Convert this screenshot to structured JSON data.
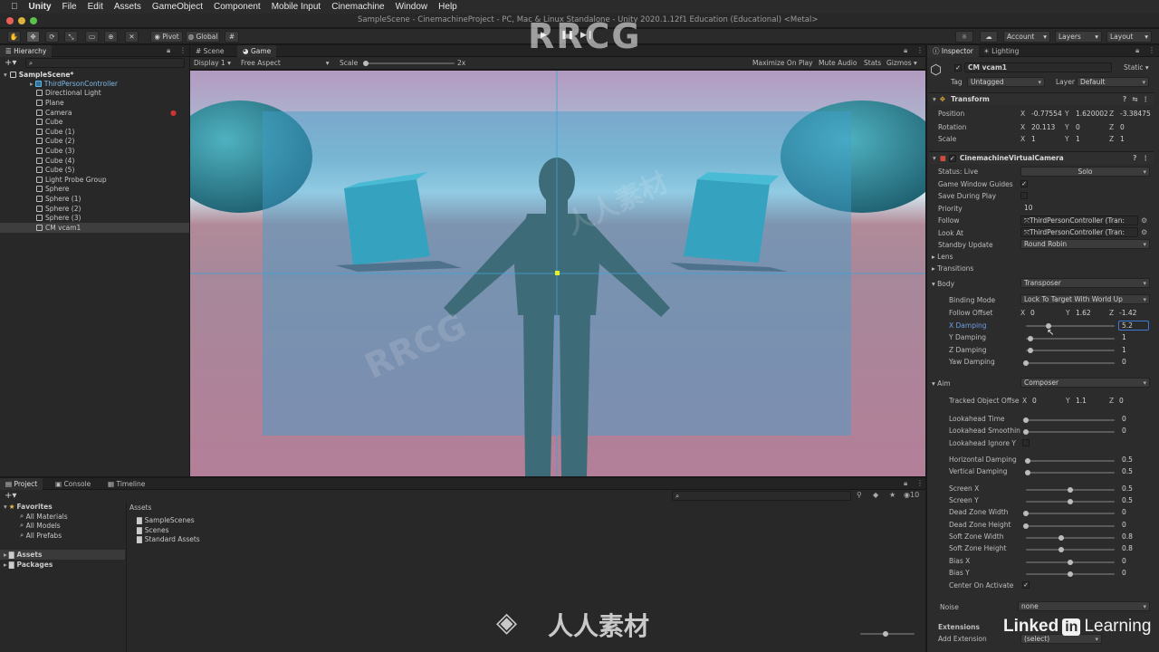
{
  "menubar": {
    "app": "Unity",
    "items": [
      "File",
      "Edit",
      "Assets",
      "GameObject",
      "Component",
      "Mobile Input",
      "Cinemachine",
      "Window",
      "Help"
    ]
  },
  "window_title": "SampleScene - CinemachineProject - PC, Mac & Linux Standalone - Unity 2020.1.12f1 Education (Educational) <Metal>",
  "toolbar": {
    "pivot": "Pivot",
    "global": "Global",
    "account": "Account",
    "layers": "Layers",
    "layout": "Layout"
  },
  "hierarchy": {
    "tab": "Hierarchy",
    "scene": "SampleScene*",
    "items": [
      "ThirdPersonController",
      "Directional Light",
      "Plane",
      "Camera",
      "Cube",
      "Cube (1)",
      "Cube (2)",
      "Cube (3)",
      "Cube (4)",
      "Cube (5)",
      "Light Probe Group",
      "Sphere",
      "Sphere (1)",
      "Sphere (2)",
      "Sphere (3)",
      "CM vcam1"
    ]
  },
  "view_tabs": {
    "scene": "Scene",
    "game": "Game",
    "display": "Display 1",
    "aspect": "Free Aspect",
    "scale_label": "Scale",
    "scale_value": "2x",
    "maximize": "Maximize On Play",
    "mute": "Mute Audio",
    "stats": "Stats",
    "gizmos": "Gizmos"
  },
  "project": {
    "tabs": [
      "Project",
      "Console",
      "Timeline"
    ],
    "favorites": "Favorites",
    "favorite_items": [
      "All Materials",
      "All Models",
      "All Prefabs"
    ],
    "roots": [
      "Assets",
      "Packages"
    ],
    "assets_header": "Assets",
    "asset_items": [
      "SampleScenes",
      "Scenes",
      "Standard Assets"
    ],
    "count": "10"
  },
  "inspector": {
    "tabs": [
      "Inspector",
      "Lighting"
    ],
    "object_name": "CM vcam1",
    "static": "Static",
    "tag_label": "Tag",
    "tag": "Untagged",
    "layer_label": "Layer",
    "layer": "Default",
    "transform": {
      "title": "Transform",
      "position_label": "Position",
      "position": [
        "-0.77554",
        "1.620002",
        "-3.38475"
      ],
      "rotation_label": "Rotation",
      "rotation": [
        "20.113",
        "0",
        "0"
      ],
      "scale_label": "Scale",
      "scale": [
        "1",
        "1",
        "1"
      ]
    },
    "vcam": {
      "title": "CinemachineVirtualCamera",
      "status": "Status: Live",
      "solo": "Solo",
      "game_window_guides": "Game Window Guides",
      "save_during_play": "Save During Play",
      "priority_label": "Priority",
      "priority": "10",
      "follow_label": "Follow",
      "follow": "ThirdPersonController (Tran:",
      "look_at_label": "Look At",
      "look_at": "ThirdPersonController (Tran:",
      "standby_label": "Standby Update",
      "standby": "Round Robin",
      "lens": "Lens",
      "transitions": "Transitions"
    },
    "body": {
      "label": "Body",
      "value": "Transposer",
      "binding_mode_label": "Binding Mode",
      "binding_mode": "Lock To Target With World Up",
      "follow_offset_label": "Follow Offset",
      "follow_offset": [
        "0",
        "1.62",
        "-1.42"
      ],
      "x_damping_label": "X Damping",
      "x_damping": "5.2",
      "x_damping_fraction": 0.26,
      "y_damping_label": "Y Damping",
      "y_damping": "1",
      "y_damping_fraction": 0.05,
      "z_damping_label": "Z Damping",
      "z_damping": "1",
      "z_damping_fraction": 0.05,
      "yaw_damping_label": "Yaw Damping",
      "yaw_damping": "0",
      "yaw_damping_fraction": 0.0
    },
    "aim": {
      "label": "Aim",
      "value": "Composer",
      "tracked_offset_label": "Tracked Object Offse",
      "tracked_offset": [
        "0",
        "1.1",
        "0"
      ],
      "sliders": [
        {
          "label": "Lookahead Time",
          "value": "0",
          "fraction": 0.0
        },
        {
          "label": "Lookahead Smoothin",
          "value": "0",
          "fraction": 0.0
        },
        {
          "label": "Horizontal Damping",
          "value": "0.5",
          "fraction": 0.02
        },
        {
          "label": "Vertical Damping",
          "value": "0.5",
          "fraction": 0.02
        },
        {
          "label": "Screen X",
          "value": "0.5",
          "fraction": 0.5
        },
        {
          "label": "Screen Y",
          "value": "0.5",
          "fraction": 0.5
        },
        {
          "label": "Dead Zone Width",
          "value": "0",
          "fraction": 0.0
        },
        {
          "label": "Dead Zone Height",
          "value": "0",
          "fraction": 0.0
        },
        {
          "label": "Soft Zone Width",
          "value": "0.8",
          "fraction": 0.4
        },
        {
          "label": "Soft Zone Height",
          "value": "0.8",
          "fraction": 0.4
        },
        {
          "label": "Bias X",
          "value": "0",
          "fraction": 0.5
        },
        {
          "label": "Bias Y",
          "value": "0",
          "fraction": 0.5
        }
      ],
      "lookahead_ignore_y": "Lookahead Ignore Y",
      "center_on_activate": "Center On Activate"
    },
    "noise_label": "Noise",
    "noise": "none",
    "extensions": "Extensions",
    "add_extension": "Add Extension",
    "select": "(select)"
  },
  "watermarks": {
    "rrcg": "RRCG",
    "cn": "人人素材",
    "linkedin": "Linked",
    "in_badge": "in",
    "learning": "Learning"
  },
  "colors": {
    "accent_selected": "#3a5a85",
    "sky": "#7fd0e6",
    "ground": "#a77a92",
    "guide_blue": "#3da0d8"
  }
}
